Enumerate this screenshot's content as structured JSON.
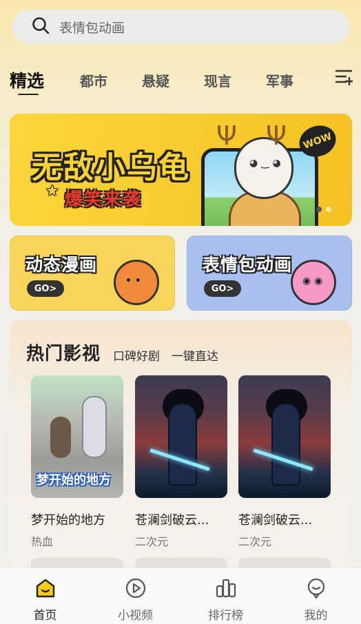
{
  "search": {
    "placeholder": "表情包动画",
    "icon": "search-icon"
  },
  "tabs": [
    {
      "label": "精选",
      "active": true
    },
    {
      "label": "都市",
      "active": false
    },
    {
      "label": "悬疑",
      "active": false
    },
    {
      "label": "现言",
      "active": false
    },
    {
      "label": "军事",
      "active": false
    }
  ],
  "banner": {
    "title": "无敌小乌龟",
    "subtitle": "爆笑来袭",
    "badge": "WOW",
    "page_index": 1,
    "page_count": 2
  },
  "cards": [
    {
      "title": "动态漫画",
      "go": "GO>"
    },
    {
      "title": "表情包动画",
      "go": "GO>"
    }
  ],
  "hot": {
    "title": "热门影视",
    "subtitle": "口碑好剧　一键直达",
    "items": [
      {
        "title": "梦开始的地方",
        "tag": "热血",
        "poster_text": "梦开始的地方"
      },
      {
        "title": "苍澜剑破云...",
        "tag": "二次元"
      },
      {
        "title": "苍澜剑破云...",
        "tag": "二次元"
      }
    ]
  },
  "nav": [
    {
      "label": "首页",
      "icon": "home-icon",
      "active": true
    },
    {
      "label": "小视频",
      "icon": "play-circle-icon",
      "active": false
    },
    {
      "label": "排行榜",
      "icon": "ranking-icon",
      "active": false
    },
    {
      "label": "我的",
      "icon": "profile-icon",
      "active": false
    }
  ],
  "colors": {
    "accent": "#f7c81e",
    "text": "#222222",
    "muted": "#777777"
  }
}
